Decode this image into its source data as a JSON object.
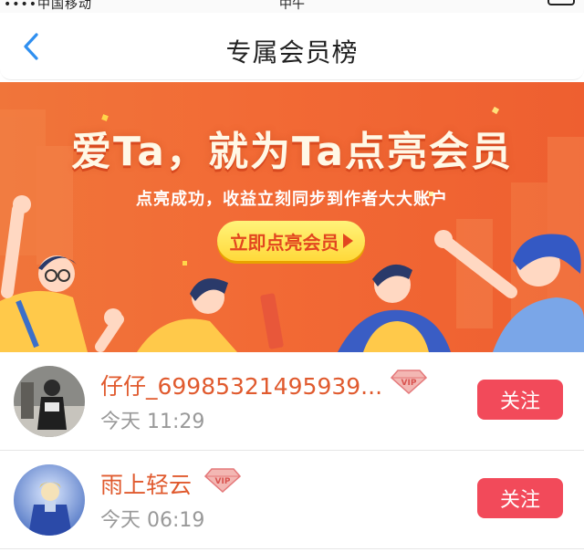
{
  "status_bar": {
    "carrier": "••••中国移动",
    "time": "中午"
  },
  "header": {
    "title": "专属会员榜",
    "back_icon": "chevron-left-icon",
    "back_color": "#2f8ff0"
  },
  "banner": {
    "title": "爱Ta，就为Ta点亮会员",
    "subtitle": "点亮成功，收益立刻同步到作者大大账户",
    "cta_label": "立即点亮会员",
    "cta_icon": "play-arrow-icon",
    "background_color": "#f06a35"
  },
  "members": [
    {
      "name": "仔仔_69985321495939...",
      "time": "今天 11:29",
      "badge": "VIP",
      "follow_label": "关注"
    },
    {
      "name": "雨上轻云",
      "time": "今天 06:19",
      "badge": "VIP",
      "follow_label": "关注"
    }
  ],
  "colors": {
    "accent_red": "#f24a5a",
    "name_orange": "#e05a2e",
    "time_gray": "#999999"
  }
}
